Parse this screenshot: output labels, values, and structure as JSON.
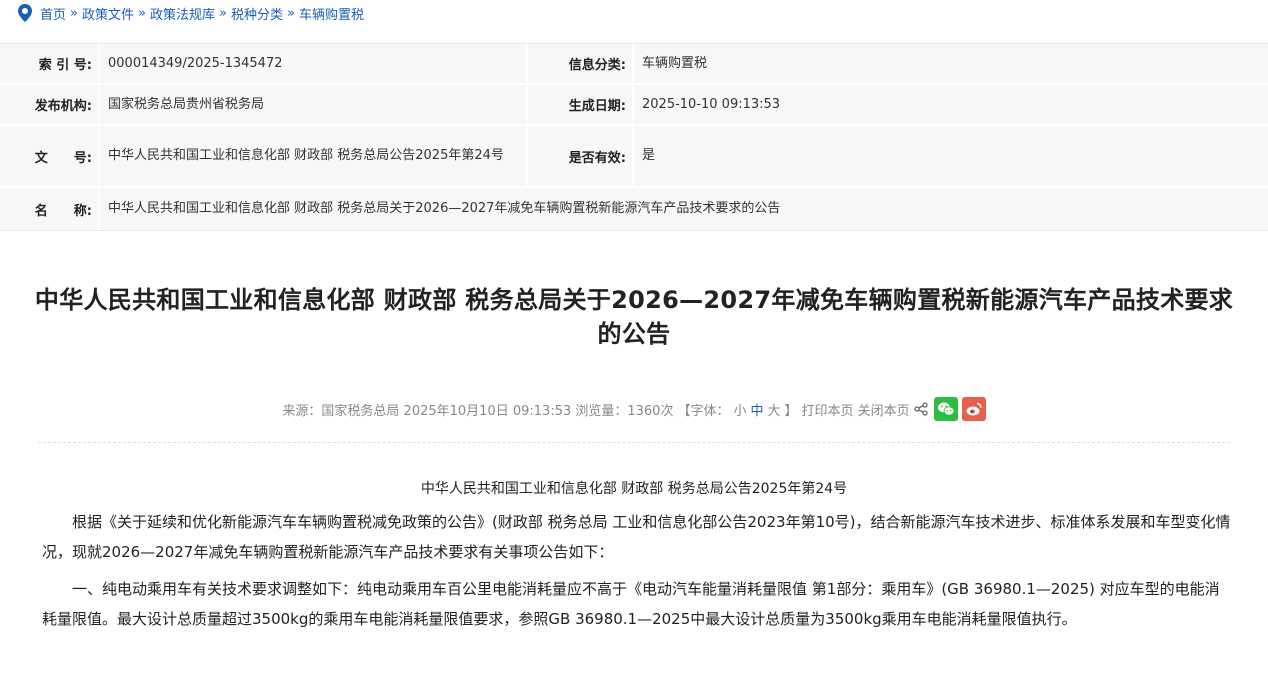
{
  "breadcrumb": {
    "items": [
      "首页",
      "政策文件",
      "政策法规库",
      "税种分类",
      "车辆购置税"
    ],
    "separator": "»"
  },
  "meta": {
    "index_label": "索 引 号:",
    "index_value": "000014349/2025-1345472",
    "category_label": "信息分类:",
    "category_value": "车辆购置税",
    "publisher_label": "发布机构:",
    "publisher_value": "国家税务总局贵州省税务局",
    "date_label": "生成日期:",
    "date_value": "2025-10-10 09:13:53",
    "docno_label": "文　　号:",
    "docno_value": "中华人民共和国工业和信息化部 财政部 税务总局公告2025年第24号",
    "valid_label": "是否有效:",
    "valid_value": "是",
    "name_label": "名　　称:",
    "name_value": "中华人民共和国工业和信息化部 财政部 税务总局关于2026—2027年减免车辆购置税新能源汽车产品技术要求的公告"
  },
  "article": {
    "title": "中华人民共和国工业和信息化部 财政部 税务总局关于2026—2027年减免车辆购置税新能源汽车产品技术要求的公告",
    "source": "来源：国家税务总局 2025年10月10日 09:13:53 浏览量：1360次",
    "font_open": "【字体：",
    "font_small": "小",
    "font_mid": "中",
    "font_large": "大",
    "font_close": "】",
    "print": "打印本页",
    "close": "关闭本页",
    "doc_no": "中华人民共和国工业和信息化部 财政部 税务总局公告2025年第24号",
    "p1": "根据《关于延续和优化新能源汽车车辆购置税减免政策的公告》(财政部 税务总局 工业和信息化部公告2023年第10号)，结合新能源汽车技术进步、标准体系发展和车型变化情况，现就2026—2027年减免车辆购置税新能源汽车产品技术要求有关事项公告如下：",
    "p2": "一、纯电动乘用车有关技术要求调整如下：纯电动乘用车百公里电能消耗量应不高于《电动汽车能量消耗量限值 第1部分：乘用车》(GB 36980.1—2025) 对应车型的电能消耗量限值。最大设计总质量超过3500kg的乘用车电能消耗量限值要求，参照GB 36980.1—2025中最大设计总质量为3500kg乘用车电能消耗量限值执行。"
  },
  "colors": {
    "link": "#1a5fb4",
    "wechat": "#2dbd42",
    "weibo": "#e85f4d"
  }
}
